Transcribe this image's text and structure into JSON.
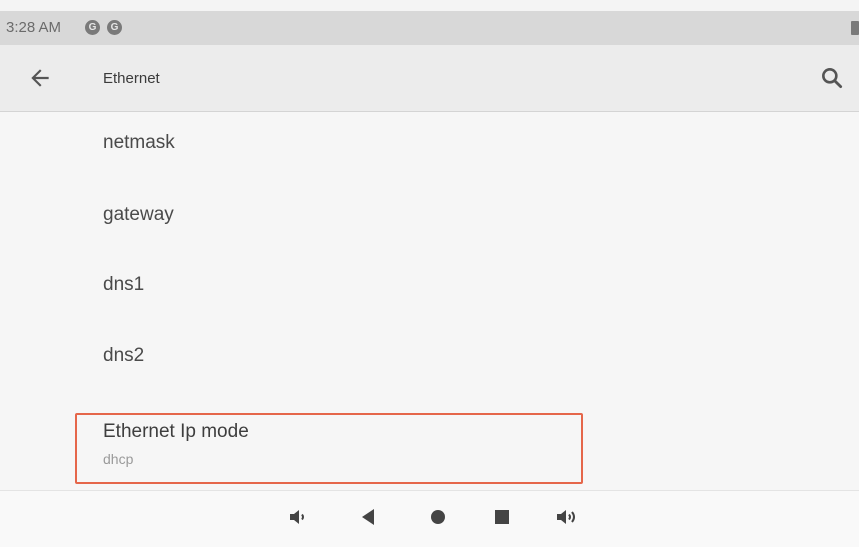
{
  "status_bar": {
    "time": "3:28 AM",
    "notification_icons": [
      "G",
      "G"
    ]
  },
  "app_bar": {
    "title": "Ethernet",
    "back_icon": "arrow-left-icon",
    "search_icon": "search-icon"
  },
  "settings": {
    "items": [
      {
        "label": "netmask"
      },
      {
        "label": "gateway"
      },
      {
        "label": "dns1"
      },
      {
        "label": "dns2"
      }
    ],
    "ip_mode": {
      "label": "Ethernet Ip mode",
      "value": "dhcp"
    }
  },
  "highlight_color": "#e5664a",
  "nav_bar": {
    "icons": [
      "volume-down-icon",
      "back-triangle-icon",
      "home-circle-icon",
      "recents-square-icon",
      "volume-up-icon"
    ]
  }
}
